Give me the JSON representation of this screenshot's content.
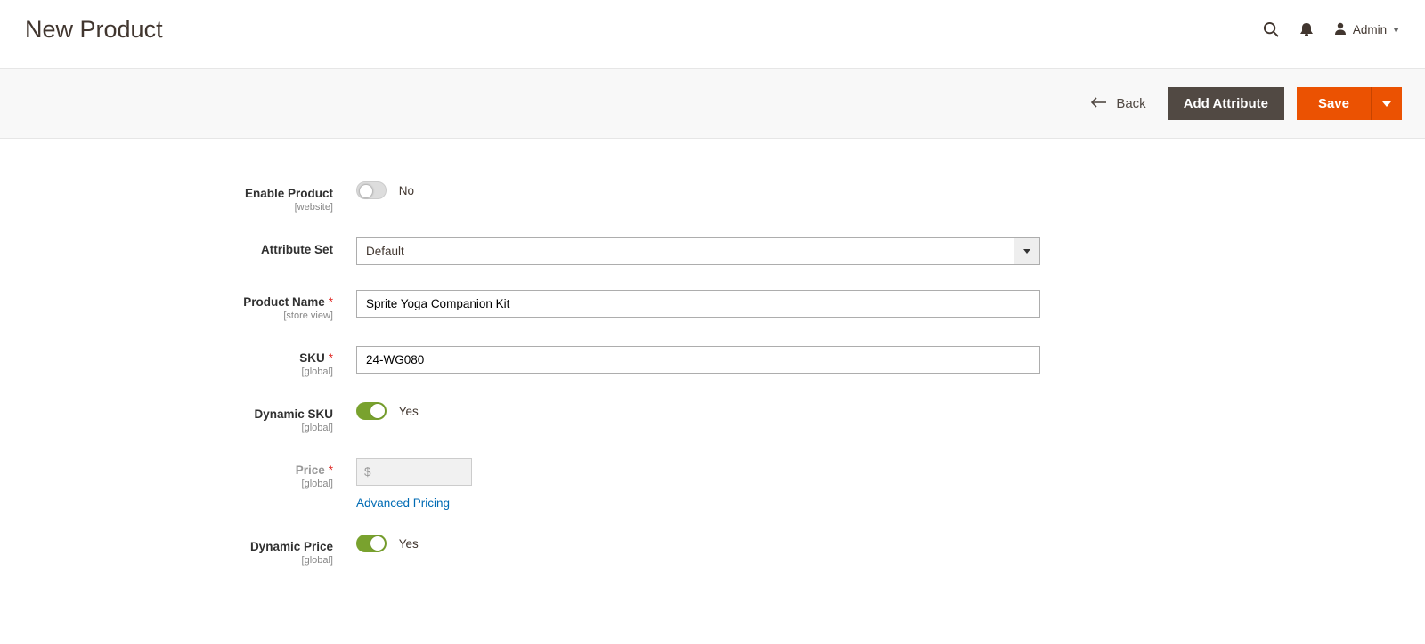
{
  "header": {
    "page_title": "New Product",
    "admin_label": "Admin"
  },
  "actions": {
    "back": "Back",
    "add_attribute": "Add Attribute",
    "save": "Save"
  },
  "fields": {
    "enable_product": {
      "label": "Enable Product",
      "scope": "[website]",
      "value_text": "No",
      "on": false
    },
    "attribute_set": {
      "label": "Attribute Set",
      "value": "Default"
    },
    "product_name": {
      "label": "Product Name",
      "scope": "[store view]",
      "value": "Sprite Yoga Companion Kit"
    },
    "sku": {
      "label": "SKU",
      "scope": "[global]",
      "value": "24-WG080"
    },
    "dynamic_sku": {
      "label": "Dynamic SKU",
      "scope": "[global]",
      "value_text": "Yes",
      "on": true
    },
    "price": {
      "label": "Price",
      "scope": "[global]",
      "currency": "$",
      "value": "",
      "advanced_link": "Advanced Pricing"
    },
    "dynamic_price": {
      "label": "Dynamic Price",
      "scope": "[global]",
      "value_text": "Yes",
      "on": true
    }
  }
}
